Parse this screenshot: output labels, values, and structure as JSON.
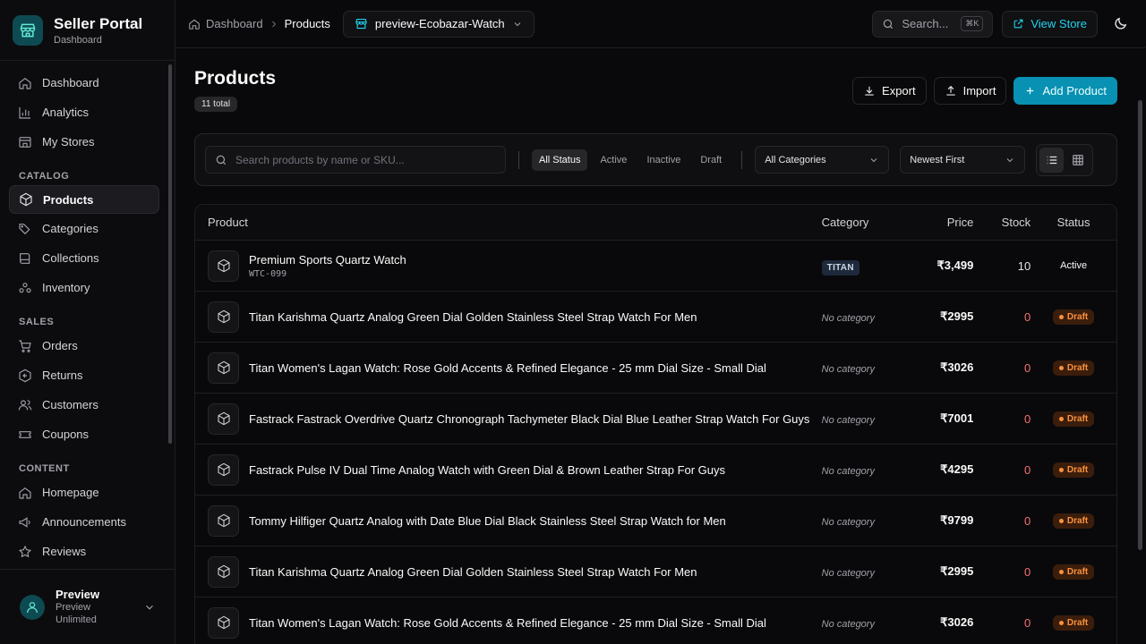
{
  "brand": {
    "title": "Seller Portal",
    "subtitle": "Dashboard"
  },
  "nav": {
    "main": [
      {
        "label": "Dashboard",
        "icon": "home-icon"
      },
      {
        "label": "Analytics",
        "icon": "bar-chart-icon"
      },
      {
        "label": "My Stores",
        "icon": "store-icon"
      }
    ],
    "catalog_heading": "CATALOG",
    "catalog": [
      {
        "label": "Products",
        "icon": "box-icon",
        "active": true
      },
      {
        "label": "Categories",
        "icon": "tags-icon"
      },
      {
        "label": "Collections",
        "icon": "book-icon"
      },
      {
        "label": "Inventory",
        "icon": "warehouse-icon"
      }
    ],
    "sales_heading": "SALES",
    "sales": [
      {
        "label": "Orders",
        "icon": "cart-icon"
      },
      {
        "label": "Returns",
        "icon": "return-icon"
      },
      {
        "label": "Customers",
        "icon": "users-icon"
      },
      {
        "label": "Coupons",
        "icon": "ticket-icon"
      }
    ],
    "content_heading": "CONTENT",
    "content": [
      {
        "label": "Homepage",
        "icon": "home-icon"
      },
      {
        "label": "Announcements",
        "icon": "megaphone-icon"
      },
      {
        "label": "Reviews",
        "icon": "star-icon"
      }
    ]
  },
  "user": {
    "name": "Preview",
    "plan_line1": "Preview",
    "plan_line2": "Unlimited"
  },
  "topbar": {
    "breadcrumb_root": "Dashboard",
    "breadcrumb_current": "Products",
    "store_name": "preview-Ecobazar-Watch",
    "search_placeholder": "Search...",
    "search_kbd": "⌘K",
    "view_store": "View Store"
  },
  "page": {
    "title": "Products",
    "count": "11 total",
    "export": "Export",
    "import": "Import",
    "add": "Add Product"
  },
  "filters": {
    "search_placeholder": "Search products by name or SKU...",
    "status_tabs": [
      "All Status",
      "Active",
      "Inactive",
      "Draft"
    ],
    "category": "All Categories",
    "sort": "Newest First"
  },
  "table": {
    "headers": {
      "product": "Product",
      "category": "Category",
      "price": "Price",
      "stock": "Stock",
      "status": "Status"
    },
    "rows": [
      {
        "name": "Premium Sports Quartz Watch",
        "sku": "WTC-099",
        "category": "TITAN",
        "price": "₹3,499",
        "stock": "10",
        "status": "Active"
      },
      {
        "name": "Titan Karishma Quartz Analog Green Dial Golden Stainless Steel Strap Watch For Men",
        "sku": "",
        "category": "No category",
        "price": "₹2995",
        "stock": "0",
        "status": "Draft"
      },
      {
        "name": "Titan Women's Lagan Watch: Rose Gold Accents & Refined Elegance - 25 mm Dial Size - Small Dial",
        "sku": "",
        "category": "No category",
        "price": "₹3026",
        "stock": "0",
        "status": "Draft"
      },
      {
        "name": "Fastrack Fastrack Overdrive Quartz Chronograph Tachymeter Black Dial Blue Leather Strap Watch For Guys",
        "sku": "",
        "category": "No category",
        "price": "₹7001",
        "stock": "0",
        "status": "Draft"
      },
      {
        "name": "Fastrack Pulse IV Dual Time Analog Watch with Green Dial & Brown Leather Strap For Guys",
        "sku": "",
        "category": "No category",
        "price": "₹4295",
        "stock": "0",
        "status": "Draft"
      },
      {
        "name": "Tommy Hilfiger Quartz Analog with Date Blue Dial Black Stainless Steel Strap Watch for Men",
        "sku": "",
        "category": "No category",
        "price": "₹9799",
        "stock": "0",
        "status": "Draft"
      },
      {
        "name": "Titan Karishma Quartz Analog Green Dial Golden Stainless Steel Strap Watch For Men",
        "sku": "",
        "category": "No category",
        "price": "₹2995",
        "stock": "0",
        "status": "Draft"
      },
      {
        "name": "Titan Women's Lagan Watch: Rose Gold Accents & Refined Elegance - 25 mm Dial Size - Small Dial",
        "sku": "",
        "category": "No category",
        "price": "₹3026",
        "stock": "0",
        "status": "Draft"
      }
    ]
  },
  "colors": {
    "accent": "#0891b2",
    "accent_text": "#22d3ee",
    "draft": "#fb923c",
    "zero_stock": "#f87171"
  }
}
